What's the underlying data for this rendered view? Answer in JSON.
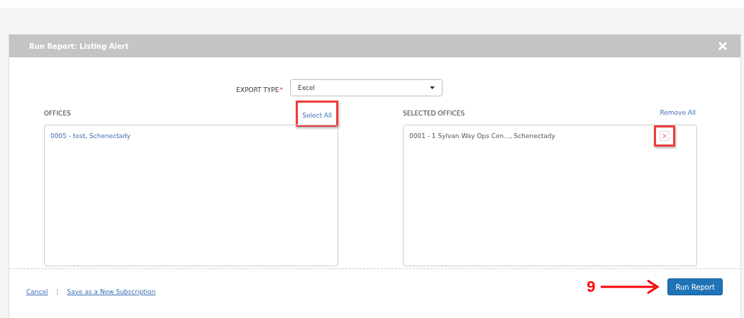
{
  "dialog": {
    "title": "Run Report: Listing Alert"
  },
  "export_type": {
    "label": "EXPORT TYPE",
    "required_mark": "*",
    "value": "Excel"
  },
  "offices": {
    "label": "OFFICES",
    "action": {
      "label": "Select All",
      "highlighted": true
    },
    "items": [
      {
        "text": "0005 - test, Schenectady",
        "removable": false
      }
    ]
  },
  "selected_offices": {
    "label": "SELECTED OFFICES",
    "action": {
      "label": "Remove All",
      "highlighted": false
    },
    "items": [
      {
        "text": "0001 - 1 Sylvan Way Ops Cen..., Schenectady",
        "removable": true,
        "highlighted": true
      }
    ]
  },
  "footer": {
    "links": [
      "Cancel",
      "Save as a New Subscription"
    ],
    "separator": "|",
    "button": "Run Report"
  },
  "annotation": {
    "step": "9"
  }
}
